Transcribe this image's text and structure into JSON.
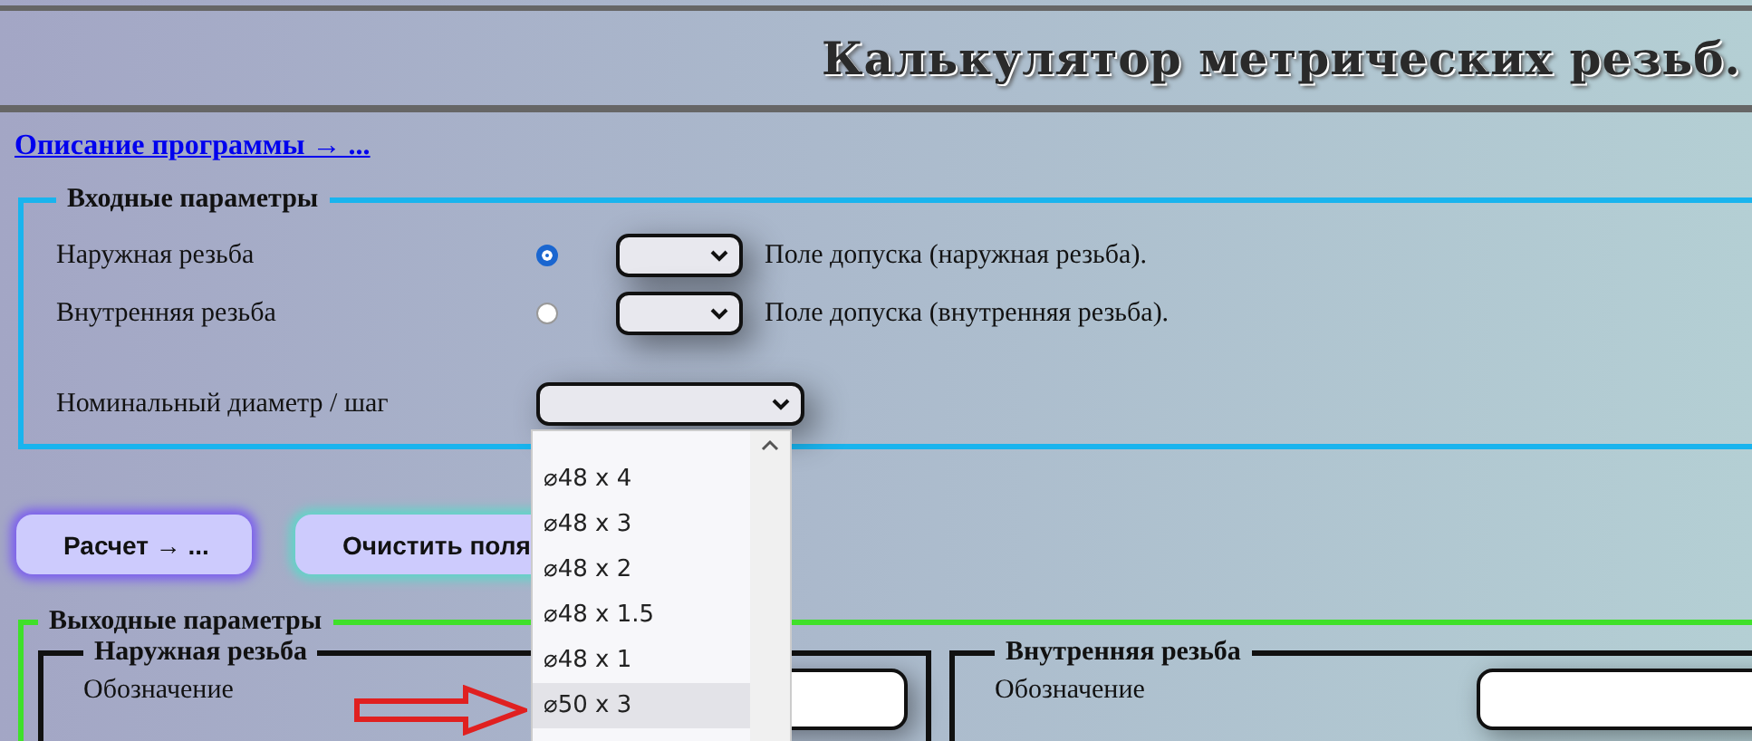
{
  "header": {
    "title": "Калькулятор метрических резьб."
  },
  "description_link": "Описание программы → ...",
  "input": {
    "legend": "Входные параметры",
    "threads": [
      {
        "label": "Наружная резьба",
        "selected": true,
        "tolerance_label": "Поле допуска (наружная резьба)."
      },
      {
        "label": "Внутренняя резьба",
        "selected": false,
        "tolerance_label": "Поле допуска (внутренняя резьба)."
      }
    ],
    "diameter_label": "Номинальный диаметр / шаг",
    "dropdown": {
      "options": [
        {
          "label": "⌀48 x 4",
          "selected": false
        },
        {
          "label": "⌀48 x 3",
          "selected": false
        },
        {
          "label": "⌀48 x 2",
          "selected": false
        },
        {
          "label": "⌀48 x 1.5",
          "selected": false
        },
        {
          "label": "⌀48 x 1",
          "selected": false
        },
        {
          "label": "⌀50 x 3",
          "selected": true
        }
      ]
    }
  },
  "buttons": [
    {
      "label": "Расчет → ..."
    },
    {
      "label": "Очистить поля"
    }
  ],
  "output": {
    "legend": "Выходные параметры",
    "groups": [
      {
        "legend": "Наружная резьба",
        "field_label": "Обозначение"
      },
      {
        "legend": "Внутренняя резьба",
        "field_label": "Обозначение"
      }
    ]
  }
}
